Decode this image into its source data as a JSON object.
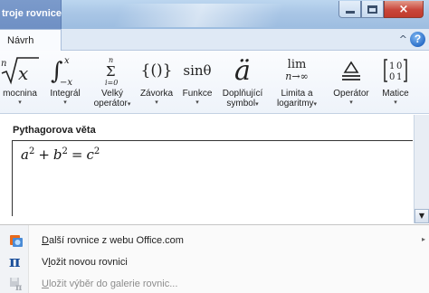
{
  "window": {
    "context_tab_title": "troje rovnice",
    "buttons": {
      "minimize": "minimize-icon",
      "maximize": "maximize-icon",
      "close": "×"
    }
  },
  "tabs": {
    "active": "Návrh",
    "collapse_glyph": "^",
    "help_glyph": "?"
  },
  "ribbon": {
    "buttons": [
      {
        "id": "mocnina",
        "glyph": "ⁿ√x",
        "label": "mocnina",
        "dropdown": "▾"
      },
      {
        "id": "integral",
        "glyph": "∫",
        "label": "Integrál",
        "dropdown": "▾"
      },
      {
        "id": "velky-operator",
        "glyph": "Σ",
        "label_line1": "Velký",
        "label_line2": "operátor",
        "dropdown": "▾"
      },
      {
        "id": "zavorka",
        "glyph": "{()}",
        "label": "Závorka",
        "dropdown": "▾"
      },
      {
        "id": "funkce",
        "glyph": "sinθ",
        "label": "Funkce",
        "dropdown": "▾"
      },
      {
        "id": "doplnujici-symbol",
        "glyph": "ä",
        "label_line1": "Doplňující",
        "label_line2": "symbol",
        "dropdown": "▾"
      },
      {
        "id": "limita",
        "glyph_top": "lim",
        "glyph_bottom": "n→∞",
        "label_line1": "Limita a",
        "label_line2": "logaritmy",
        "dropdown": "▾"
      },
      {
        "id": "operator",
        "glyph": "≜",
        "label": "Operátor",
        "dropdown": "▾"
      },
      {
        "id": "matice",
        "glyph": "[10 01]",
        "label": "Matice",
        "dropdown": "▾"
      }
    ]
  },
  "document": {
    "equation_title": "Pythagorova věta",
    "equation": {
      "a": "a",
      "b": "b",
      "c": "c",
      "exp": "2",
      "plus": "+",
      "equals": "="
    }
  },
  "menu": {
    "items": [
      {
        "icon": "office-online-icon",
        "label_underline": "D",
        "label_rest": "alší rovnice z webu Office.com",
        "has_submenu": true,
        "submenu_arrow": "▸"
      },
      {
        "icon": "pi-icon",
        "icon_glyph": "π",
        "label_pre": "V",
        "label_underline": "l",
        "label_rest": "ožit novou rovnici"
      },
      {
        "icon": "save-equation-icon",
        "label_underline": "U",
        "label_rest": "ložit výběr do galerie rovnic...",
        "disabled": true
      }
    ]
  },
  "colors": {
    "accent": "#1b4f9a",
    "titlebar": "#a9c6e6",
    "context_tab": "#6f90c4",
    "close_button": "#c9463a"
  }
}
